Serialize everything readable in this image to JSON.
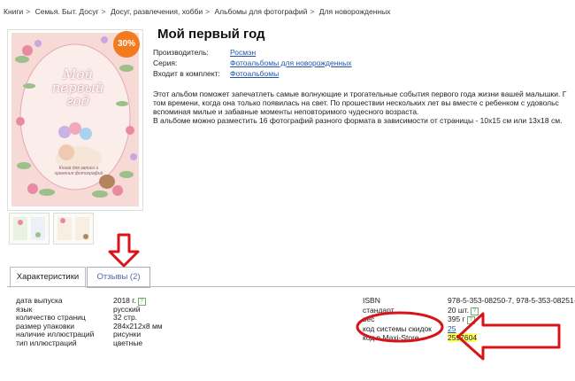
{
  "breadcrumb": [
    "Книги",
    "Семья. Быт. Досуг",
    "Досуг, развлечения, хобби",
    "Альбомы для фотографий",
    "Для новорожденных"
  ],
  "breadcrumb_sep": ">",
  "product": {
    "title": "Мой первый год",
    "discount": "30%",
    "cover_title": "Мой первый год",
    "cover_subtitle": "Книга для записи и хранения фотографий"
  },
  "props": [
    {
      "label": "Производитель:",
      "value": "Росмэн"
    },
    {
      "label": "Серия:",
      "value": "Фотоальбомы для новорожденных"
    },
    {
      "label": "Входит в комплект:",
      "value": "Фотоальбомы"
    }
  ],
  "description": [
    "Этот альбом поможет запечатлеть самые волнующие и трогательные события первого года жизни вашей малышки. Г",
    "том времени, когда она только появилась на свет. По прошествии нескольких лет вы вместе с ребенком с удовольс",
    "вспоминая милые и забавные моменты неповторимого чудесного возраста.",
    "В альбоме можно разместить 16 фотографий разного формата в зависимости от страницы - 10х15 см или 13х18 см."
  ],
  "tabs": [
    {
      "label": "Характеристики",
      "active": true
    },
    {
      "label": "Отзывы (2)",
      "active": false
    }
  ],
  "characteristics_left": [
    {
      "label": "дата выпуска",
      "value": "2018 г.",
      "help": true
    },
    {
      "label": "язык",
      "value": "русский",
      "help": false
    },
    {
      "label": "количество страниц",
      "value": "32 стр.",
      "help": false
    },
    {
      "label": "размер упаковки",
      "value": "284х212х8 мм",
      "help": false
    },
    {
      "label": "наличие иллюстраций",
      "value": "рисунки",
      "help": false
    },
    {
      "label": "тип иллюстраций",
      "value": "цветные",
      "help": false
    }
  ],
  "characteristics_right": [
    {
      "label": "ISBN",
      "value": "978-5-353-08250-7, 978-5-353-08251-"
    },
    {
      "label": "стандарт",
      "value": "20 шт."
    },
    {
      "label": "вес",
      "value": "395 г"
    },
    {
      "label": "код системы скидок",
      "value": "25"
    },
    {
      "label": "код в Maxi-Store",
      "value": "2597604"
    }
  ],
  "help_glyph": "?",
  "colors": {
    "accent": "#f47a1f",
    "annotation": "#d8141b",
    "link": "#2255aa",
    "highlight": "#ffff66"
  }
}
